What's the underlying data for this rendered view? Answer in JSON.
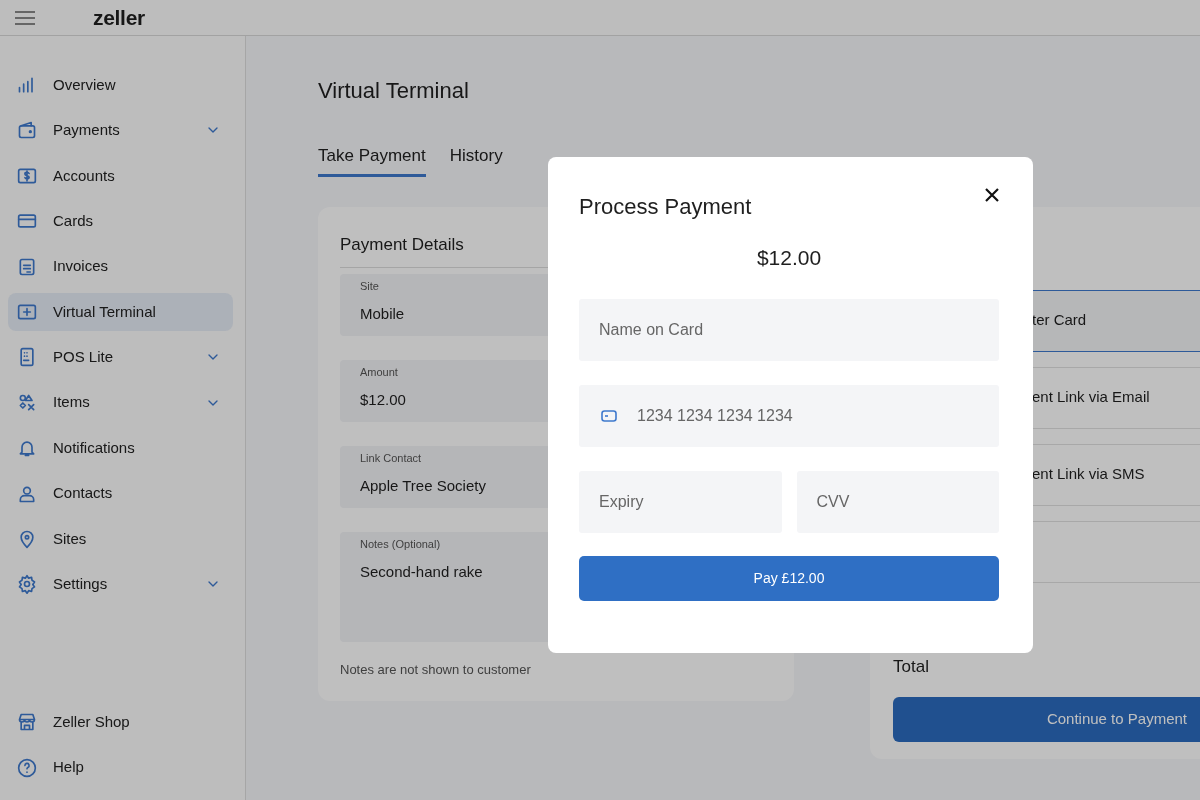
{
  "top_bar": {
    "logo": "zeller"
  },
  "sidebar": {
    "items": [
      {
        "label": "Overview",
        "selected": false,
        "expandable": false
      },
      {
        "label": "Payments",
        "selected": false,
        "expandable": true
      },
      {
        "label": "Accounts",
        "selected": false,
        "expandable": false
      },
      {
        "label": "Cards",
        "selected": false,
        "expandable": false
      },
      {
        "label": "Invoices",
        "selected": false,
        "expandable": false
      },
      {
        "label": "Virtual Terminal",
        "selected": true,
        "expandable": false
      },
      {
        "label": "POS Lite",
        "selected": false,
        "expandable": true
      },
      {
        "label": "Items",
        "selected": false,
        "expandable": true
      },
      {
        "label": "Notifications",
        "selected": false,
        "expandable": false
      },
      {
        "label": "Contacts",
        "selected": false,
        "expandable": false
      },
      {
        "label": "Sites",
        "selected": false,
        "expandable": false
      },
      {
        "label": "Settings",
        "selected": false,
        "expandable": true
      }
    ],
    "footer_items": [
      {
        "label": "Zeller Shop"
      },
      {
        "label": "Help"
      }
    ]
  },
  "page": {
    "title": "Virtual Terminal",
    "tabs": [
      {
        "label": "Take Payment",
        "selected": true
      },
      {
        "label": "History",
        "selected": false
      }
    ],
    "payment_details": {
      "title": "Payment Details",
      "fields": [
        {
          "label": "Site",
          "value": "Mobile",
          "kind": "single"
        },
        {
          "label": "Amount",
          "value": "$12.00",
          "kind": "single"
        },
        {
          "label": "Link Contact",
          "value": "Apple Tree Society",
          "kind": "single"
        },
        {
          "label": "Notes (Optional)",
          "value": "Second-hand rake",
          "kind": "multi"
        }
      ],
      "note": "Notes are not shown to customer"
    },
    "payment_options": {
      "options": [
        {
          "label": "ter Card",
          "selected": true
        },
        {
          "label": "ent Link via Email",
          "selected": false
        },
        {
          "label": "ent Link via SMS",
          "selected": false
        },
        {
          "selected": false
        }
      ],
      "total_label": "Total",
      "button": "Continue to Payment"
    }
  },
  "modal": {
    "title": "Process Payment",
    "amount": "$12.00",
    "fields": [
      {
        "placeholder": "Name on Card",
        "kind": "full"
      },
      {
        "placeholder": "1234 1234 1234 1234",
        "kind": "card"
      },
      {
        "placeholder": "Expiry",
        "kind": "half"
      },
      {
        "placeholder": "CVV",
        "kind": "half"
      }
    ],
    "button": "Pay £12.00"
  }
}
